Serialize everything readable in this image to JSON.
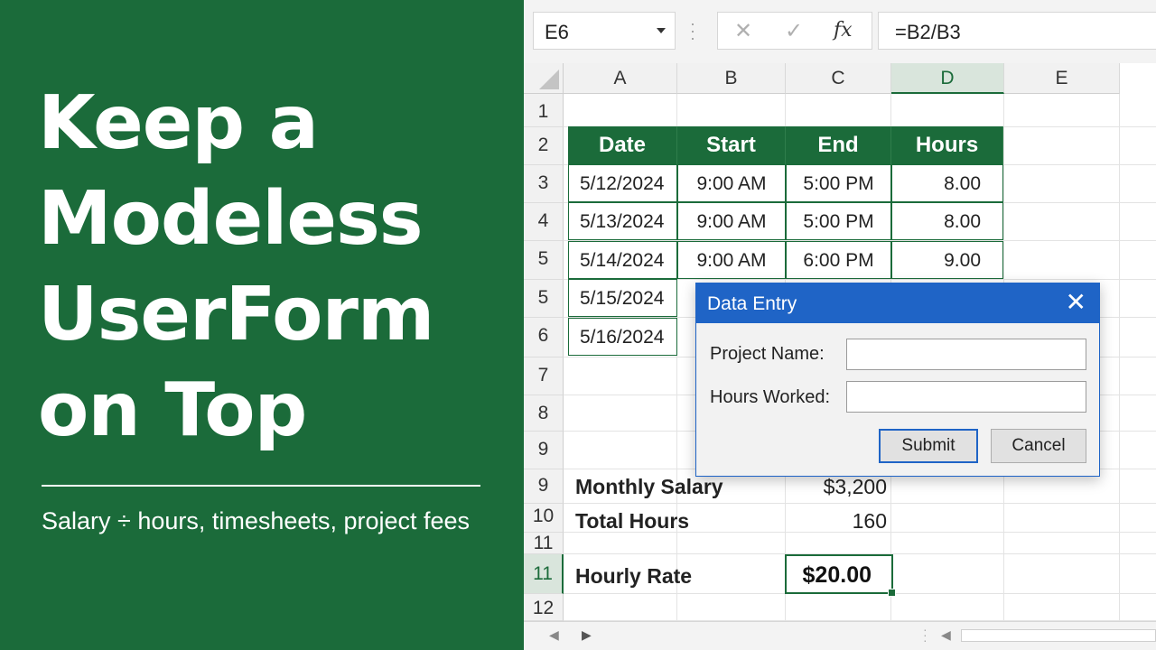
{
  "banner": {
    "headline_lines": [
      "Keep a",
      "Modeless",
      "UserForm",
      "on Top"
    ],
    "subtitle": "Salary ÷ hours, timesheets, project fees",
    "background_color": "#1b6b3a"
  },
  "formula_bar": {
    "name_box": "E6",
    "cancel_icon": "✕",
    "confirm_icon": "✓",
    "function_icon": "fx",
    "formula": "=B2/B3"
  },
  "columns": [
    "A",
    "B",
    "C",
    "D",
    "E"
  ],
  "active_column": "D",
  "row_numbers": [
    "1",
    "2",
    "3",
    "4",
    "5",
    "5",
    "6",
    "7",
    "8",
    "9",
    "9",
    "10",
    "11",
    "11",
    "12"
  ],
  "active_row": "11",
  "timesheet": {
    "headers": [
      "Date",
      "Start",
      "End",
      "Hours"
    ],
    "rows": [
      [
        "5/12/2024",
        "9:00 AM",
        "5:00 PM",
        "8.00"
      ],
      [
        "5/13/2024",
        "9:00 AM",
        "5:00 PM",
        "8.00"
      ],
      [
        "5/14/2024",
        "9:00 AM",
        "6:00 PM",
        "9.00"
      ],
      [
        "5/15/2024",
        "",
        "",
        ""
      ],
      [
        "5/16/2024",
        "",
        "",
        ""
      ]
    ]
  },
  "summary": {
    "salary_label": "Monthly Salary",
    "salary_value": "$3,200",
    "hours_label": "Total Hours",
    "hours_value": "160",
    "rate_label": "Hourly Rate",
    "rate_value": "$20.00"
  },
  "userform": {
    "title": "Data Entry",
    "close_icon": "✕",
    "project_label": "Project Name:",
    "project_value": "",
    "hours_label": "Hours Worked:",
    "hours_value": "",
    "submit_label": "Submit",
    "cancel_label": "Cancel",
    "title_bar_color": "#1f64c6"
  },
  "footer": {
    "scroll_left_icon": "◀",
    "scroll_right_icon": "▶",
    "hscroll_left_icon": "◀"
  }
}
